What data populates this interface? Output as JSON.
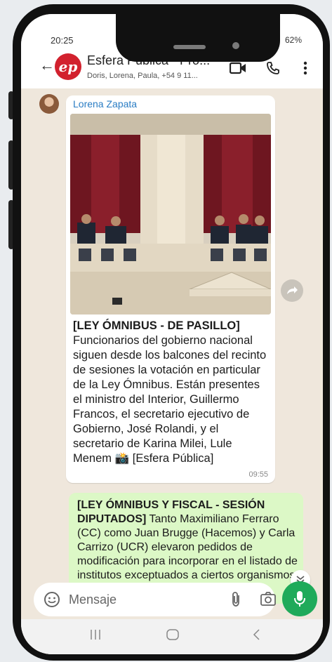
{
  "status": {
    "time": "20:25",
    "battery": "62%"
  },
  "header": {
    "logo_text": "ep",
    "title": "Esfera Pública - Pro...",
    "subtitle": "Doris, Lorena, Paula, +54 9 11..."
  },
  "messages": [
    {
      "sender": "Lorena Zapata",
      "headline": "[LEY ÓMNIBUS - DE PASILLO]",
      "body": "Funcionarios del gobierno nacional siguen desde los balcones del recinto de sesiones la votación en particular de la Ley Ómnibus. Están presentes el ministro del Interior, Guillermo Francos, el secretario ejecutivo de Gobierno, José Rolandi, y el secretario de Karina Milei, Lule Menem 📸 [Esfera Pública]",
      "time": "09:55"
    },
    {
      "headline": "[LEY ÓMNIBUS Y FISCAL - SESIÓN DIPUTADOS]",
      "body": "Tanto Maximiliano Ferraro (CC) como Juan Brugge (Hacemos) y Carla Carrizo (UCR) elevaron pedidos de modificación para incorporar en el listado de institutos exceptuados a ciertos organismos vinculados con la ciencia,"
    }
  ],
  "composer": {
    "placeholder": "Mensaje"
  },
  "colors": {
    "accent": "#1faa5a",
    "sender": "#2a7dc4",
    "outgoing": "#dcf8c6",
    "logo": "#d2212e"
  }
}
